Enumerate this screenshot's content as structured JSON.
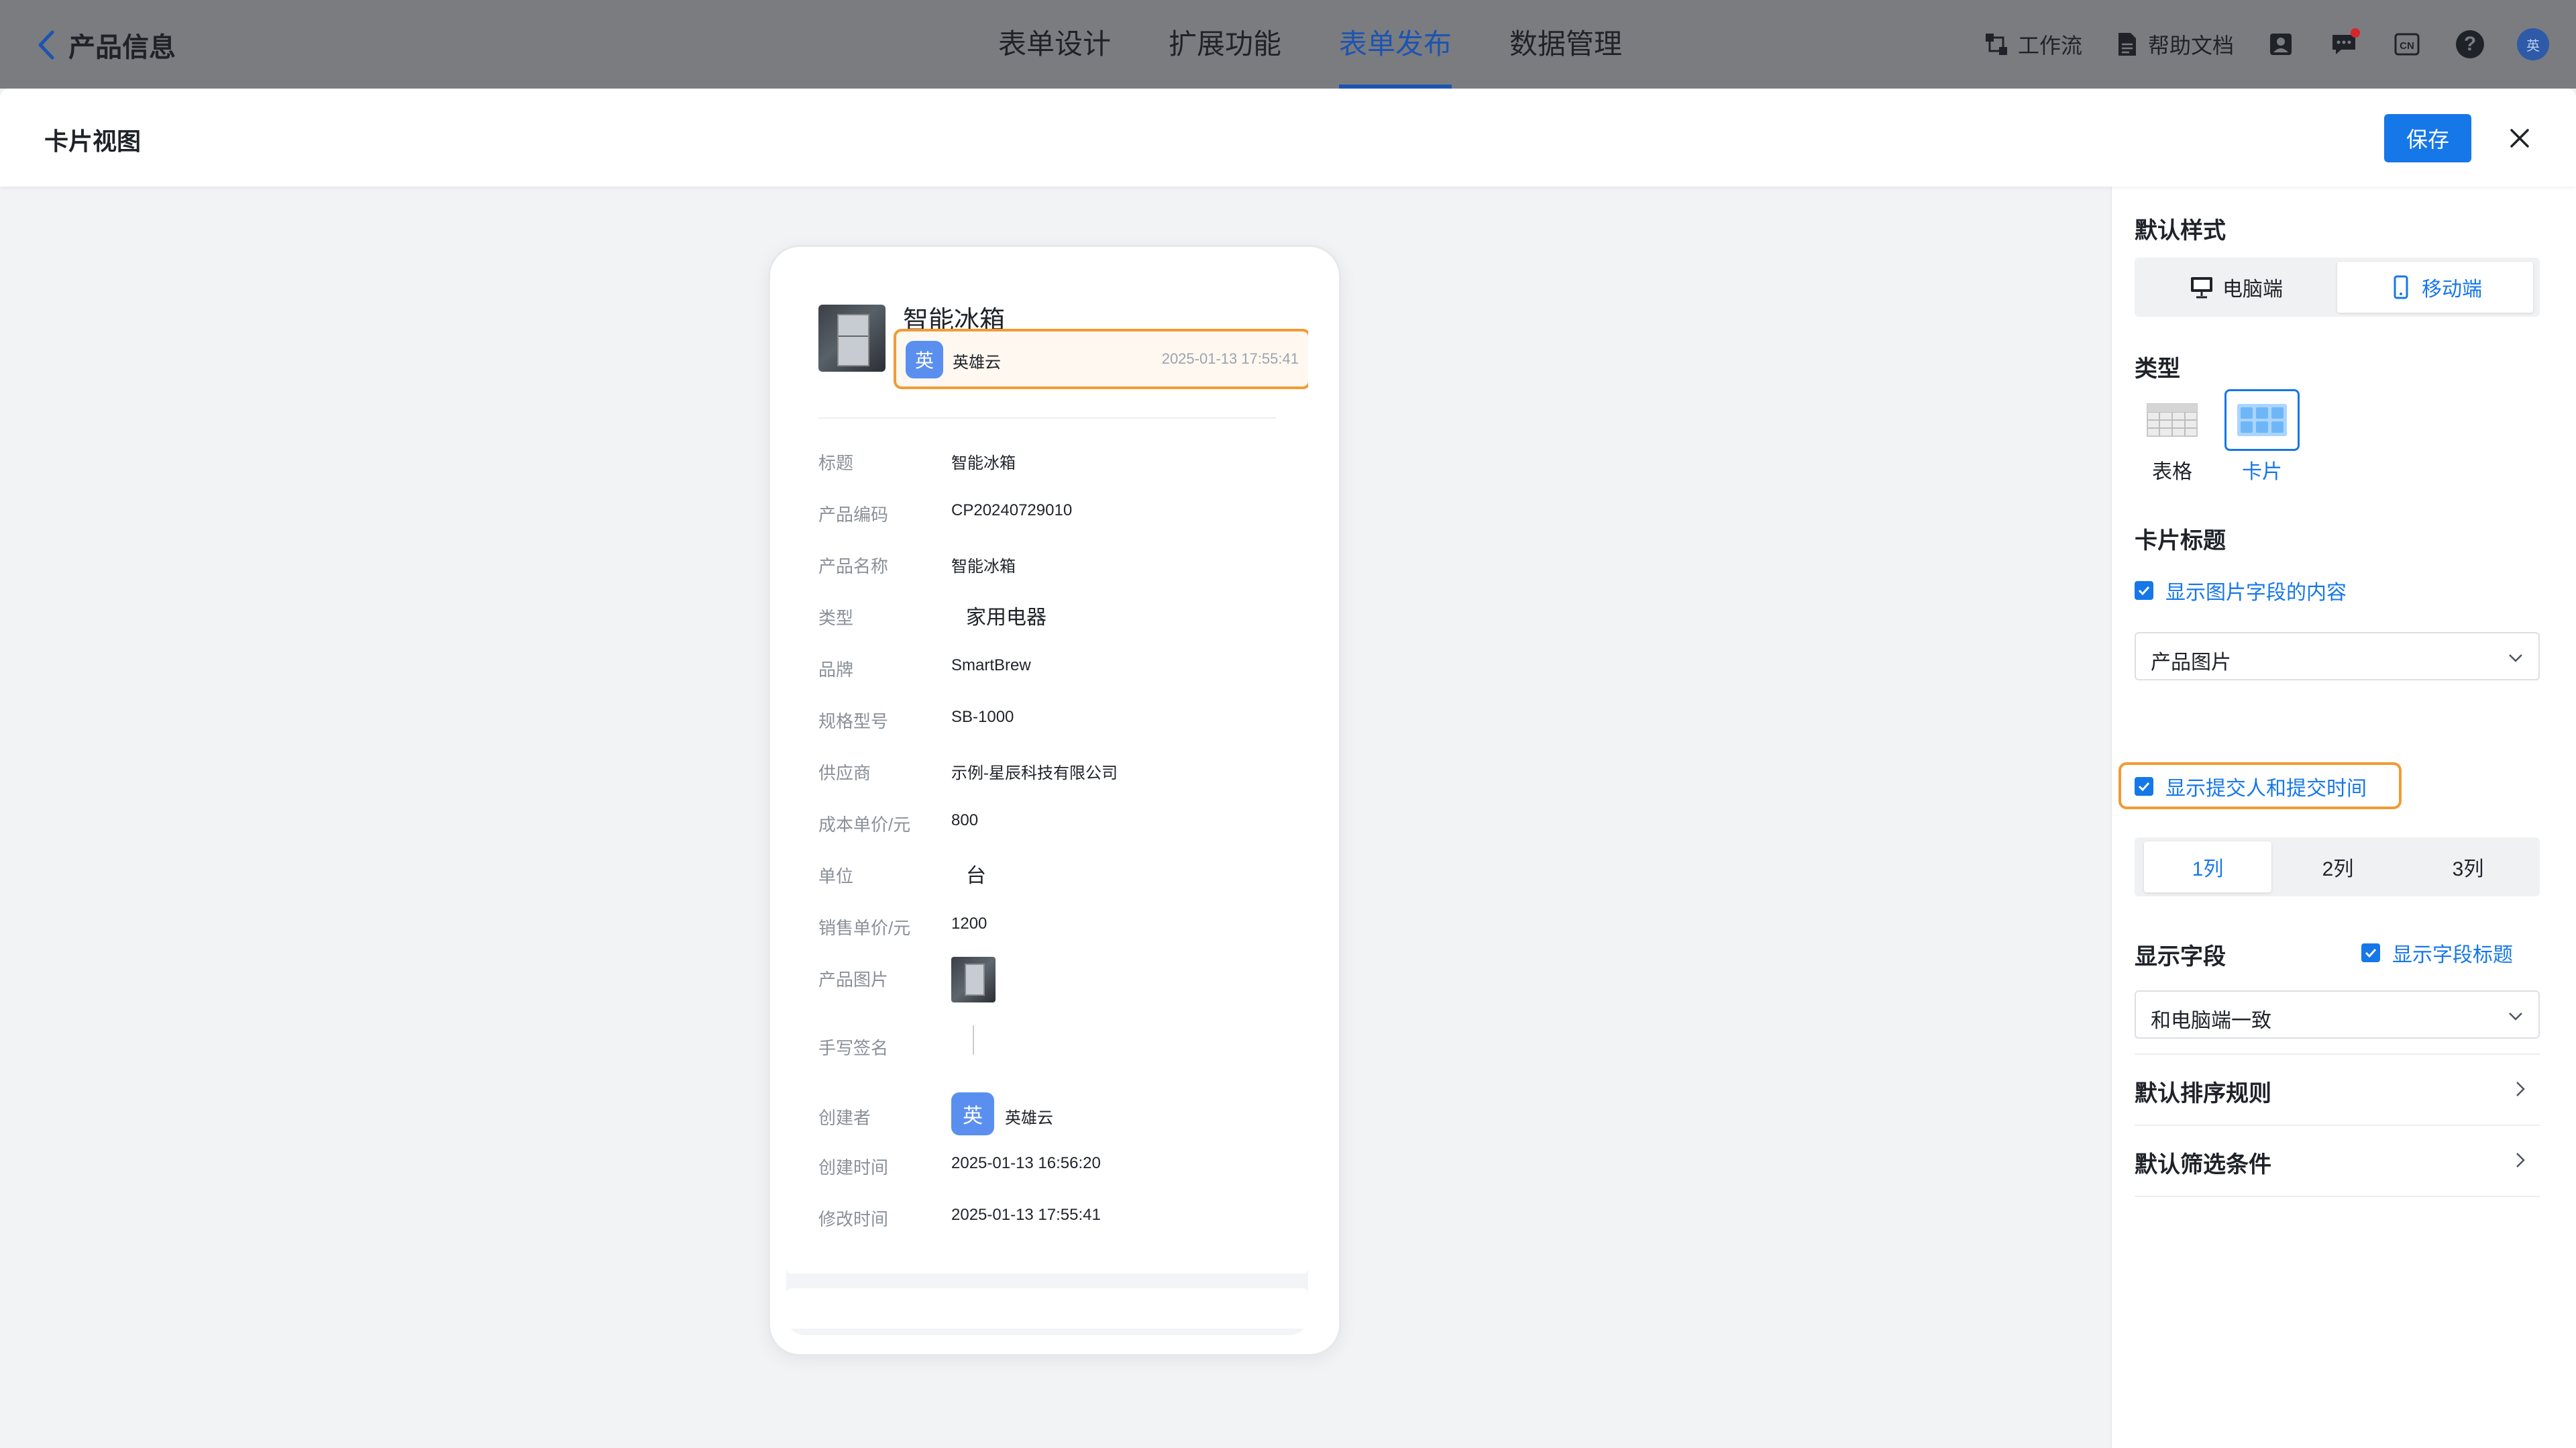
{
  "topbar": {
    "back_title": "产品信息",
    "nav": [
      "表单设计",
      "扩展功能",
      "表单发布",
      "数据管理"
    ],
    "workflow": "工作流",
    "help_doc": "帮助文档",
    "lang": "CN",
    "help": "?",
    "user_initial": "英"
  },
  "modal": {
    "title": "卡片视图",
    "save": "保存"
  },
  "card": {
    "title": "智能冰箱",
    "submitter_initial": "英",
    "submitter": "英雄云",
    "submit_time": "2025-01-13 17:55:41",
    "fields": [
      {
        "label": "标题",
        "value": "智能冰箱"
      },
      {
        "label": "产品编码",
        "value": "CP20240729010"
      },
      {
        "label": "产品名称",
        "value": "智能冰箱"
      },
      {
        "label": "类型",
        "value": "家用电器"
      },
      {
        "label": "品牌",
        "value": "SmartBrew"
      },
      {
        "label": "规格型号",
        "value": "SB-1000"
      },
      {
        "label": "供应商",
        "value": "示例-星辰科技有限公司"
      },
      {
        "label": "成本单价/元",
        "value": "800"
      },
      {
        "label": "单位",
        "value": "台"
      },
      {
        "label": "销售单价/元",
        "value": "1200"
      },
      {
        "label": "产品图片",
        "value": ""
      },
      {
        "label": "手写签名",
        "value": ""
      },
      {
        "label": "创建者",
        "value": "英雄云",
        "initial": "英"
      },
      {
        "label": "创建时间",
        "value": "2025-01-13 16:56:20"
      },
      {
        "label": "修改时间",
        "value": "2025-01-13 17:55:41"
      }
    ]
  },
  "panel": {
    "default_style": "默认样式",
    "pc": "电脑端",
    "mobile": "移动端",
    "type": "类型",
    "type_table": "表格",
    "type_card": "卡片",
    "card_title": "卡片标题",
    "show_image_field": "显示图片字段的内容",
    "image_field_select": "产品图片",
    "show_submitter": "显示提交人和提交时间",
    "columns": [
      "1列",
      "2列",
      "3列"
    ],
    "display_fields": "显示字段",
    "show_field_title": "显示字段标题",
    "fields_select": "和电脑端一致",
    "sort_rule": "默认排序规则",
    "filter": "默认筛选条件"
  }
}
